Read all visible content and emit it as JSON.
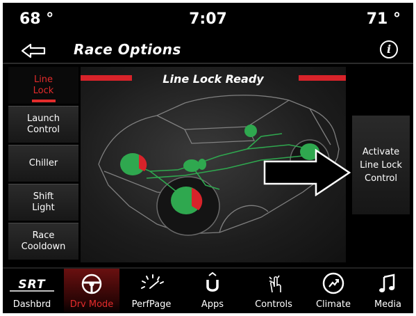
{
  "status_bar": {
    "temp_left": "68 °",
    "time": "7:07",
    "temp_right": "71 °"
  },
  "header": {
    "title": "Race Options",
    "back_icon": "back-arrow-icon",
    "info_label": "i"
  },
  "side_options": [
    {
      "label": "Line Lock",
      "active": true
    },
    {
      "label": "Launch Control",
      "active": false
    },
    {
      "label": "Chiller",
      "active": false
    },
    {
      "label": "Shift Light",
      "active": false
    },
    {
      "label": "Race Cooldown",
      "active": false
    }
  ],
  "panel": {
    "status_title": "Line Lock Ready"
  },
  "activate_button": {
    "label": "Activate Line Lock Control"
  },
  "bottom_nav": [
    {
      "label": "Dashbrd",
      "icon": "srt-logo-icon",
      "active": false
    },
    {
      "label": "Drv Mode",
      "icon": "steering-wheel-icon",
      "active": true
    },
    {
      "label": "PerfPage",
      "icon": "performance-gauge-icon",
      "active": false
    },
    {
      "label": "Apps",
      "icon": "uconnect-apps-icon",
      "active": false
    },
    {
      "label": "Controls",
      "icon": "touch-hand-icon",
      "active": false
    },
    {
      "label": "Climate",
      "icon": "climate-fan-icon",
      "active": false
    },
    {
      "label": "Media",
      "icon": "music-note-icon",
      "active": false
    }
  ],
  "colors": {
    "accent_red": "#e32b2b",
    "background": "#000000",
    "brake_green": "#2fa84f"
  }
}
